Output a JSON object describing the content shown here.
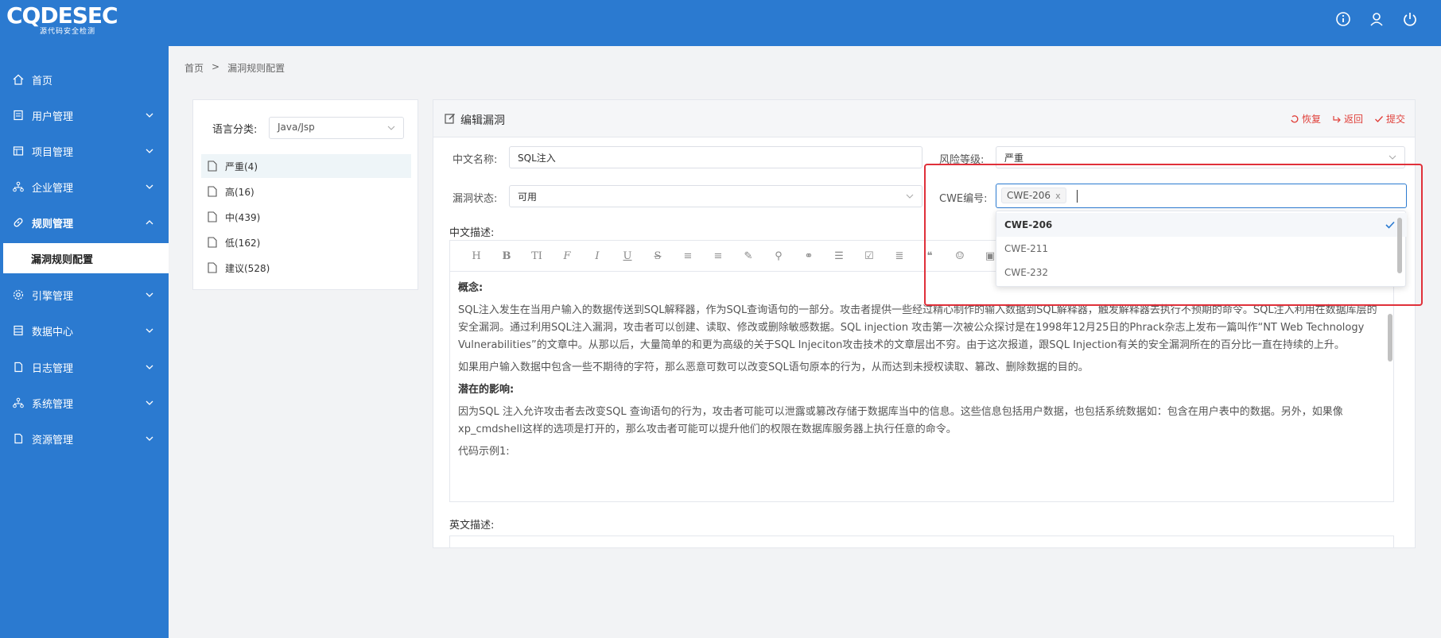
{
  "app": {
    "logo_text": "CQDESEC",
    "logo_subtitle": "源代码安全检测"
  },
  "header_icons": [
    "info-icon",
    "user-icon",
    "power-icon"
  ],
  "sidebar": {
    "items": [
      {
        "label": "首页",
        "icon": "home-icon"
      },
      {
        "label": "用户管理",
        "icon": "user-list-icon"
      },
      {
        "label": "项目管理",
        "icon": "project-icon"
      },
      {
        "label": "企业管理",
        "icon": "enterprise-icon"
      },
      {
        "label": "规则管理",
        "icon": "link-icon"
      },
      {
        "label": "引擎管理",
        "icon": "engine-icon"
      },
      {
        "label": "数据中心",
        "icon": "data-icon"
      },
      {
        "label": "日志管理",
        "icon": "log-icon"
      },
      {
        "label": "系统管理",
        "icon": "system-icon"
      },
      {
        "label": "资源管理",
        "icon": "resource-icon"
      }
    ],
    "active_sub": "漏洞规则配置"
  },
  "breadcrumb": {
    "home": "首页",
    "sep": ">",
    "current": "漏洞规则配置"
  },
  "left_panel": {
    "lang_label": "语言分类:",
    "lang_value": "Java/Jsp",
    "categories": [
      {
        "label": "严重(4)"
      },
      {
        "label": "高(16)"
      },
      {
        "label": "中(439)"
      },
      {
        "label": "低(162)"
      },
      {
        "label": "建议(528)"
      }
    ]
  },
  "editor_panel": {
    "title": "编辑漏洞",
    "actions": {
      "restore": "恢复",
      "back": "返回",
      "submit": "提交"
    },
    "fields": {
      "cn_name_label": "中文名称:",
      "cn_name_value": "SQL注入",
      "risk_label": "风险等级:",
      "risk_value": "严重",
      "status_label": "漏洞状态:",
      "status_value": "可用",
      "cwe_label": "CWE编号:",
      "cwe_tag": "CWE-206",
      "cwe_tag_close": "x"
    },
    "cn_desc_label": "中文描述:",
    "en_desc_label": "英文描述:",
    "toolbar": [
      "H",
      "B",
      "TI",
      "F",
      "I",
      "U",
      "S",
      "≡",
      "≡",
      "✎",
      "⚲",
      "⚭",
      "☰",
      "☑",
      "≣",
      "❝",
      "☺",
      "▣"
    ],
    "content": {
      "p1_heading": "概念:",
      "p1": "SQL注入发生在当用户输入的数据传送到SQL解释器，作为SQL查询语句的一部分。攻击者提供一些经过精心制作的输入数据到SQL解释器，触发解释器去执行不预期的命令。SQL注入利用在数据库层的安全漏洞。通过利用SQL注入漏洞，攻击者可以创建、读取、修改或删除敏感数据。SQL injection 攻击第一次被公众探讨是在1998年12月25日的Phrack杂志上发布一篇叫作“NT Web Technology Vulnerabilities”的文章中。从那以后，大量简单的和更为高级的关于SQL Injeciton攻击技术的文章层出不穷。由于这次报道，跟SQL Injection有关的安全漏洞所在的百分比一直在持续的上升。",
      "p2": "如果用户输入数据中包含一些不期待的字符，那么恶意可数可以改变SQL语句原本的行为，从而达到未授权读取、篡改、删除数据的目的。",
      "p3_heading": "潜在的影响:",
      "p3": "因为SQL 注入允许攻击者去改变SQL 查询语句的行为，攻击者可能可以泄露或篡改存储于数据库当中的信息。这些信息包括用户数据，也包括系统数据如：包含在用户表中的数据。另外，如果像xp_cmdshell这样的选项是打开的，那么攻击者可能可以提升他们的权限在数据库服务器上执行任意的命令。",
      "p4": "代码示例1:"
    }
  },
  "dropdown": {
    "options": [
      {
        "label": "CWE-206",
        "selected": true
      },
      {
        "label": "CWE-211",
        "selected": false
      },
      {
        "label": "CWE-232",
        "selected": false
      }
    ]
  },
  "colors": {
    "brand": "#2b7ad0",
    "danger": "#e0303a"
  }
}
